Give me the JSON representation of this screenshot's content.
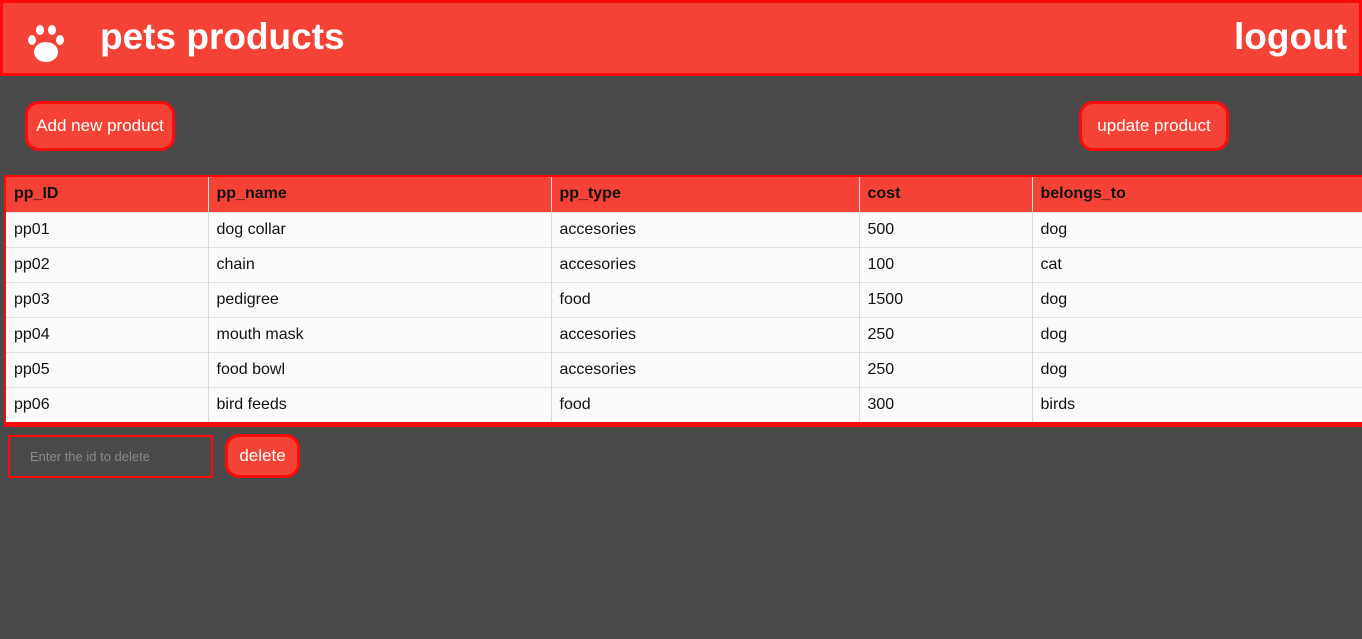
{
  "header": {
    "brand_icon": "paw-icon",
    "title": "pets products",
    "logout_label": "logout"
  },
  "actions": {
    "add_label": "Add new product",
    "update_label": "update product"
  },
  "table": {
    "columns": [
      "pp_ID",
      "pp_name",
      "pp_type",
      "cost",
      "belongs_to"
    ],
    "rows": [
      [
        "pp01",
        "dog collar",
        "accesories",
        "500",
        "dog"
      ],
      [
        "pp02",
        "chain",
        "accesories",
        "100",
        "cat"
      ],
      [
        "pp03",
        "pedigree",
        "food",
        "1500",
        "dog"
      ],
      [
        "pp04",
        "mouth mask",
        "accesories",
        "250",
        "dog"
      ],
      [
        "pp05",
        "food bowl",
        "accesories",
        "250",
        "dog"
      ],
      [
        "pp06",
        "bird feeds",
        "food",
        "300",
        "birds"
      ]
    ]
  },
  "delete_form": {
    "placeholder": "Enter the id to delete",
    "value": "",
    "button_label": "delete"
  },
  "colors": {
    "accent": "#f44336",
    "accent_border": "#ff0a0a",
    "background": "#4a4a4a"
  }
}
